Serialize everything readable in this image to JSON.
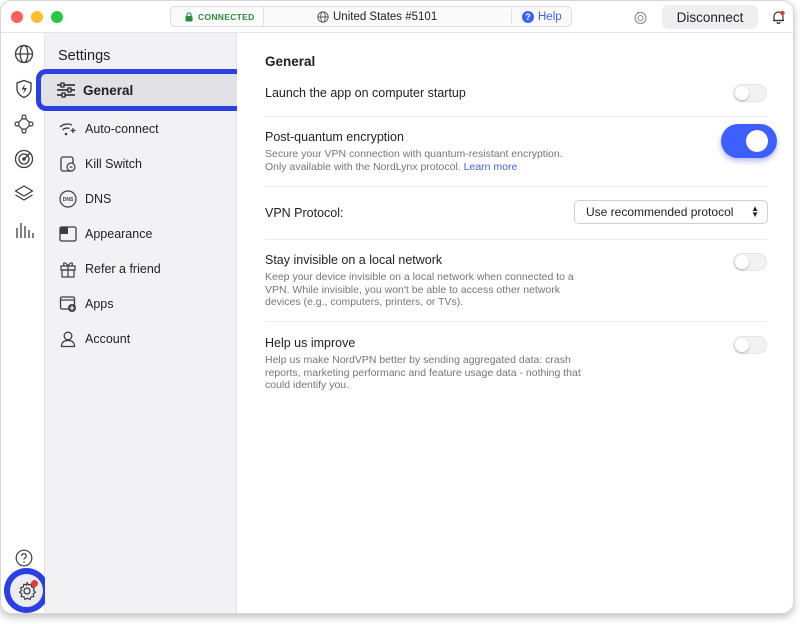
{
  "titlebar": {
    "status": "CONNECTED",
    "server": "United States #5101",
    "help": "Help",
    "disconnect": "Disconnect",
    "colors": {
      "close": "#ff5f57",
      "minimize": "#febc2e",
      "zoom": "#28c840",
      "connected": "#2d8a3e",
      "accent": "#3e5fff"
    }
  },
  "rail": {
    "icons": [
      "globe-icon",
      "shield-bolt-icon",
      "meshnet-icon",
      "target-icon",
      "layers-icon",
      "stats-icon",
      "help-circle-icon",
      "gear-icon"
    ]
  },
  "settings": {
    "title": "Settings",
    "items": [
      {
        "label": "General",
        "icon": "sliders-icon"
      },
      {
        "label": "Auto-connect",
        "icon": "wifi-spark-icon"
      },
      {
        "label": "Kill Switch",
        "icon": "kill-switch-icon"
      },
      {
        "label": "DNS",
        "icon": "dns-icon"
      },
      {
        "label": "Appearance",
        "icon": "appearance-icon"
      },
      {
        "label": "Refer a friend",
        "icon": "gift-icon"
      },
      {
        "label": "Apps",
        "icon": "apps-icon"
      },
      {
        "label": "Account",
        "icon": "user-icon"
      }
    ]
  },
  "general": {
    "title": "General",
    "launch_startup": {
      "title": "Launch the app on computer startup",
      "enabled": false
    },
    "post_quantum": {
      "title": "Post-quantum encryption",
      "desc1": "Secure your VPN connection with quantum-resistant encryption.",
      "desc2": "Only available with the NordLynx protocol.",
      "link": "Learn more",
      "enabled": true
    },
    "vpn_protocol": {
      "title": "VPN Protocol:",
      "value": "Use recommended protocol"
    },
    "invisible": {
      "title": "Stay invisible on a local network",
      "desc": [
        "Keep your device invisible on a local network when connected to a",
        "VPN. While invisible, you won't be able to access other network",
        "devices (e.g., computers, printers, or TVs)."
      ],
      "enabled": false
    },
    "improve": {
      "title": "Help us improve",
      "desc": [
        "Help us make NordVPN better by sending aggregated data: crash",
        "reports, marketing performanc and feature usage data - nothing that",
        "could identify you."
      ],
      "enabled": false
    }
  }
}
